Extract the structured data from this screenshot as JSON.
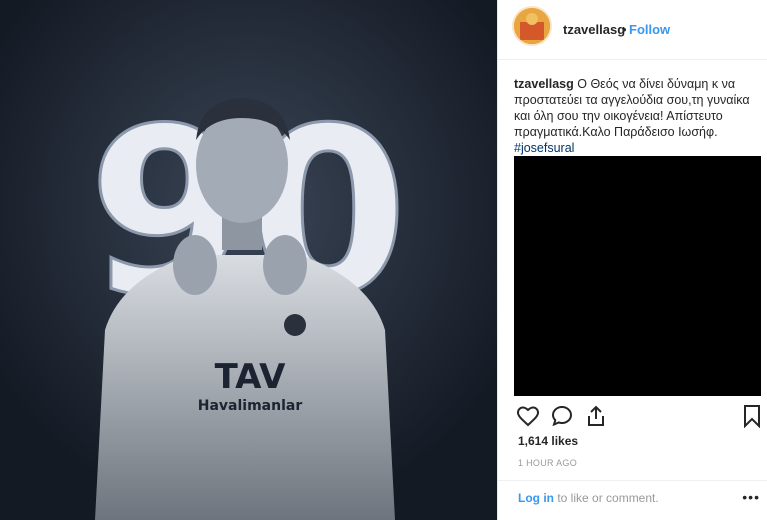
{
  "post": {
    "image": {
      "number_text": "90",
      "shirt_text": "TAV",
      "shirt_subtext": "Havalimanlar"
    },
    "header": {
      "username": "tzavellasg",
      "separator": "•",
      "follow": "Follow"
    },
    "caption": {
      "username": "tzavellasg",
      "text": "Ο Θεός να δίνει δύναμη κ να προστατεύει τα αγγελούδια σου,τη γυναίκα και όλη σου την οικογένεια! Απίστευτο πραγματικά.Καλο Παράδεισο Ιωσήφ.",
      "hashtag": "#josefsural"
    },
    "likes": "1,614 likes",
    "time": "1 HOUR AGO",
    "login": {
      "link": "Log in",
      "rest": " to like or comment.",
      "more": "•••"
    },
    "icons": [
      "heart-icon",
      "comment-icon",
      "share-icon",
      "bookmark-icon"
    ]
  },
  "colors": {
    "accent": "#3897f0",
    "text": "#262626",
    "muted": "#999999",
    "photo_bg": "#1c2431"
  }
}
